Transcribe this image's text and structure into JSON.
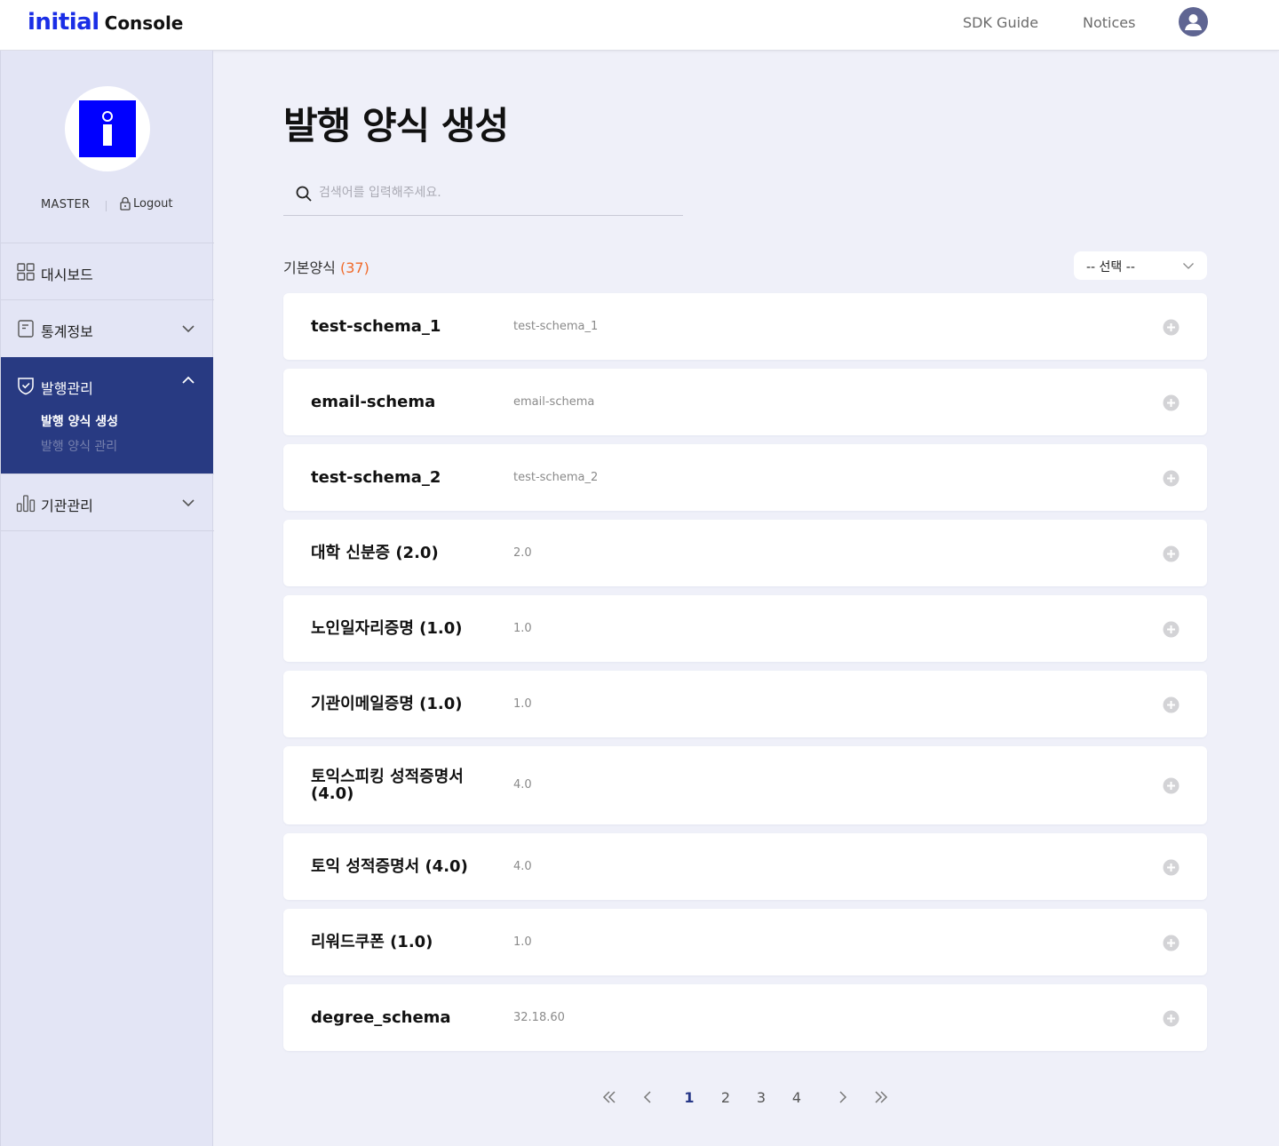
{
  "header": {
    "logo_part1": "initial",
    "logo_part2": "Console",
    "nav": [
      "SDK Guide",
      "Notices"
    ],
    "avatar_icon": "user-icon"
  },
  "sidebar": {
    "profile": {
      "role": "MASTER",
      "logout_label": "Logout"
    },
    "menu": [
      {
        "label": "대시보드",
        "icon": "dashboard-grid-icon"
      },
      {
        "label": "통계정보",
        "icon": "document-icon"
      },
      {
        "label": "발행관리",
        "icon": "shield-check-icon",
        "submenu": [
          "발행 양식 생성",
          "발행 양식 관리"
        ]
      },
      {
        "label": "기관관리",
        "icon": "bar-chart-icon"
      }
    ]
  },
  "main": {
    "title": "발행 양식 생성",
    "search_placeholder": "검색어를 입력해주세요.",
    "list_label": "기본양식",
    "list_count": "(37)",
    "select_label": "-- 선택 --",
    "rows": [
      {
        "name": "test-schema_1",
        "sub": "test-schema_1"
      },
      {
        "name": "email-schema",
        "sub": "email-schema"
      },
      {
        "name": "test-schema_2",
        "sub": "test-schema_2"
      },
      {
        "name": "대학 신분증 (2.0)",
        "sub": "2.0"
      },
      {
        "name": "노인일자리증명 (1.0)",
        "sub": "1.0"
      },
      {
        "name": "기관이메일증명 (1.0)",
        "sub": "1.0"
      },
      {
        "name": "토익스피킹 성적증명서 (4.0)",
        "sub": "4.0"
      },
      {
        "name": "토익 성적증명서 (4.0)",
        "sub": "4.0"
      },
      {
        "name": "리워드쿠폰 (1.0)",
        "sub": "1.0"
      },
      {
        "name": "degree_schema",
        "sub": "32.18.60"
      }
    ],
    "pagination": {
      "pages": [
        "1",
        "2",
        "3",
        "4"
      ],
      "current": "1"
    }
  },
  "colors": {
    "brand_blue": "#1a2ee6",
    "sidebar_active": "#283a82",
    "count_orange": "#f06a2a",
    "page_bg": "#eff0f9",
    "sidebar_bg": "#e3e5f5"
  }
}
